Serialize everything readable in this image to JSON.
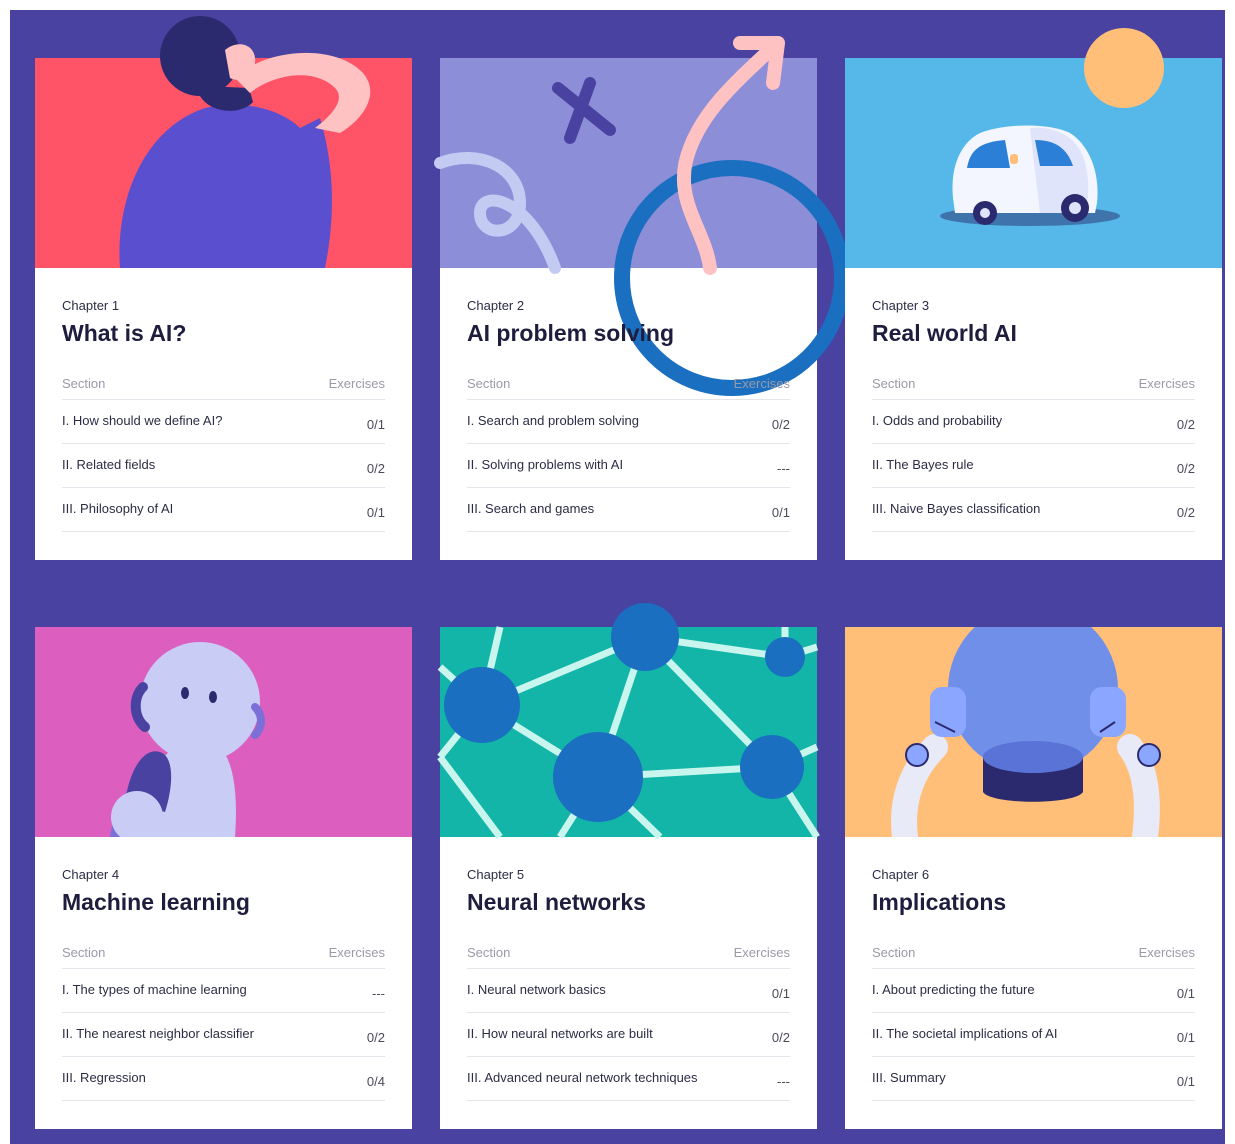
{
  "chapters": [
    {
      "label": "Chapter 1",
      "title": "What is AI?",
      "section_header": "Section",
      "exercises_header": "Exercises",
      "sections": [
        {
          "name": "I. How should we define AI?",
          "exercises": "0/1"
        },
        {
          "name": "II. Related fields",
          "exercises": "0/2"
        },
        {
          "name": "III. Philosophy of AI",
          "exercises": "0/1"
        }
      ],
      "color": "#ff5468"
    },
    {
      "label": "Chapter 2",
      "title": "AI problem solving",
      "section_header": "Section",
      "exercises_header": "Exercises",
      "sections": [
        {
          "name": "I. Search and problem solving",
          "exercises": "0/2"
        },
        {
          "name": "II. Solving problems with AI",
          "exercises": "---"
        },
        {
          "name": "III. Search and games",
          "exercises": "0/1"
        }
      ],
      "color": "#8c8ed8"
    },
    {
      "label": "Chapter 3",
      "title": "Real world AI",
      "section_header": "Section",
      "exercises_header": "Exercises",
      "sections": [
        {
          "name": "I. Odds and probability",
          "exercises": "0/2"
        },
        {
          "name": "II. The Bayes rule",
          "exercises": "0/2"
        },
        {
          "name": "III. Naive Bayes classification",
          "exercises": "0/2"
        }
      ],
      "color": "#55b8e8"
    },
    {
      "label": "Chapter 4",
      "title": "Machine learning",
      "section_header": "Section",
      "exercises_header": "Exercises",
      "sections": [
        {
          "name": "I. The types of machine learning",
          "exercises": "---"
        },
        {
          "name": "II. The nearest neighbor classifier",
          "exercises": "0/2"
        },
        {
          "name": "III. Regression",
          "exercises": "0/4"
        }
      ],
      "color": "#dc5fc0"
    },
    {
      "label": "Chapter 5",
      "title": "Neural networks",
      "section_header": "Section",
      "exercises_header": "Exercises",
      "sections": [
        {
          "name": "I. Neural network basics",
          "exercises": "0/1"
        },
        {
          "name": "II. How neural networks are built",
          "exercises": "0/2"
        },
        {
          "name": "III. Advanced neural network techniques",
          "exercises": "---"
        }
      ],
      "color": "#13b5a8"
    },
    {
      "label": "Chapter 6",
      "title": "Implications",
      "section_header": "Section",
      "exercises_header": "Exercises",
      "sections": [
        {
          "name": "I. About predicting the future",
          "exercises": "0/1"
        },
        {
          "name": "II. The societal implications of AI",
          "exercises": "0/1"
        },
        {
          "name": "III. Summary",
          "exercises": "0/1"
        }
      ],
      "color": "#ffbf78"
    }
  ],
  "colors": {
    "background": "#4a42a0",
    "card": "#ffffff",
    "title_text": "#1f1d3d",
    "muted_text": "#9a9aa8"
  },
  "icons": [
    "thinking-person-illustration",
    "path-arrow-illustration",
    "self-driving-car-illustration",
    "robot-illustration",
    "neural-network-illustration",
    "robot-holding-sphere-illustration"
  ]
}
